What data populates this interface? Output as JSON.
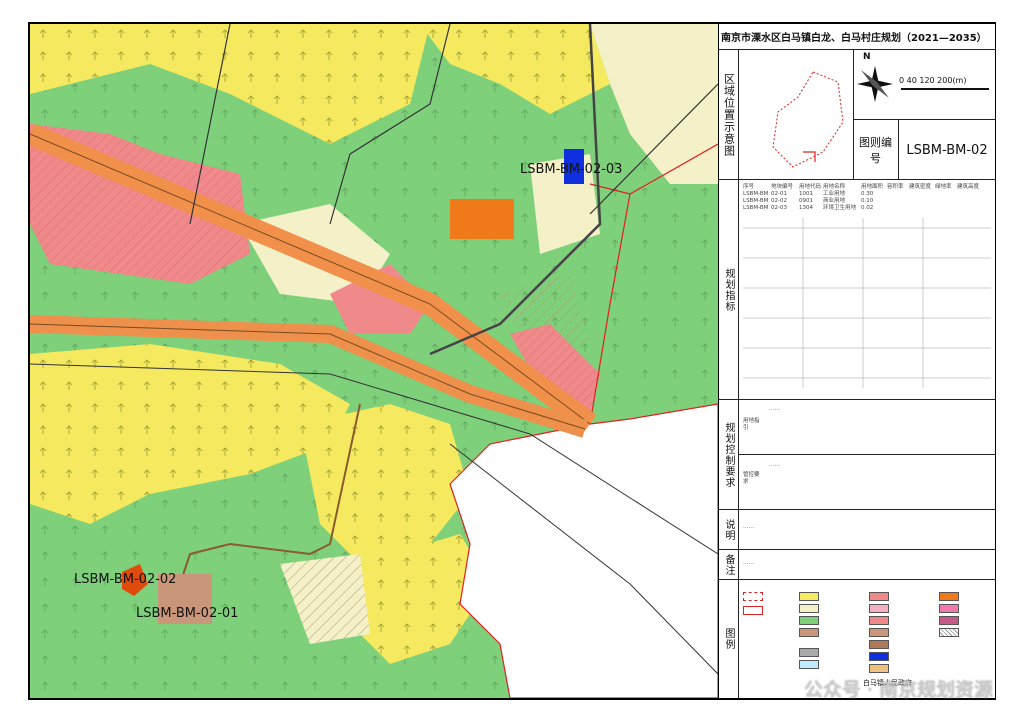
{
  "title": "南京市溧水区白马镇白龙、白马村庄规划（2021—2035）",
  "panel": {
    "location_label": "区域位置示意图",
    "code_label": "图则编号",
    "code_value": "LSBM-BM-02",
    "scale_text": "0  40    120  200(m)",
    "north_label": "N",
    "info_label": "规划指标",
    "control_label": "规划控制要求",
    "notes_label": "说明",
    "legend_label": "图例",
    "remark_label": "备注",
    "sub_label_a": "用地指引",
    "sub_label_b": "管控要求",
    "table_headers": [
      "序号",
      "地块编号",
      "用地代码",
      "用地名称",
      "用地面积",
      "容积率",
      "建筑密度",
      "绿地率",
      "建筑高度",
      "备注"
    ],
    "table_rows": [
      [
        "LSBM-BM",
        "02-01",
        "1001",
        "工业用地",
        "0.30",
        "",
        "",
        "",
        "",
        ""
      ],
      [
        "LSBM-BM",
        "02-02",
        "0901",
        "商业用地",
        "0.10",
        "",
        "",
        "",
        "",
        ""
      ],
      [
        "LSBM-BM",
        "02-03",
        "1304",
        "环境卫生用地",
        "0.02",
        "",
        "",
        "",
        "",
        ""
      ]
    ],
    "control_text_a": "……",
    "control_text_b": "……",
    "notes_text": "……",
    "remark_text": "……",
    "footer": "白马镇人民政府"
  },
  "map_labels": {
    "parcel_03": "LSBM-BM-02-03",
    "parcel_02": "LSBM-BM-02-02",
    "parcel_01": "LSBM-BM-02-01"
  },
  "legend_colors": {
    "farmland": "#f5e960",
    "forest": "#7ed07a",
    "village": "#f08a8a",
    "industrial": "#c9967a",
    "commercial": "#f07a1a",
    "sanitation": "#1030e0",
    "road": "#f0904a",
    "water": "#bfeafc",
    "other": "#f4f0c8"
  },
  "watermark": "公众号 · 南京规划资源"
}
